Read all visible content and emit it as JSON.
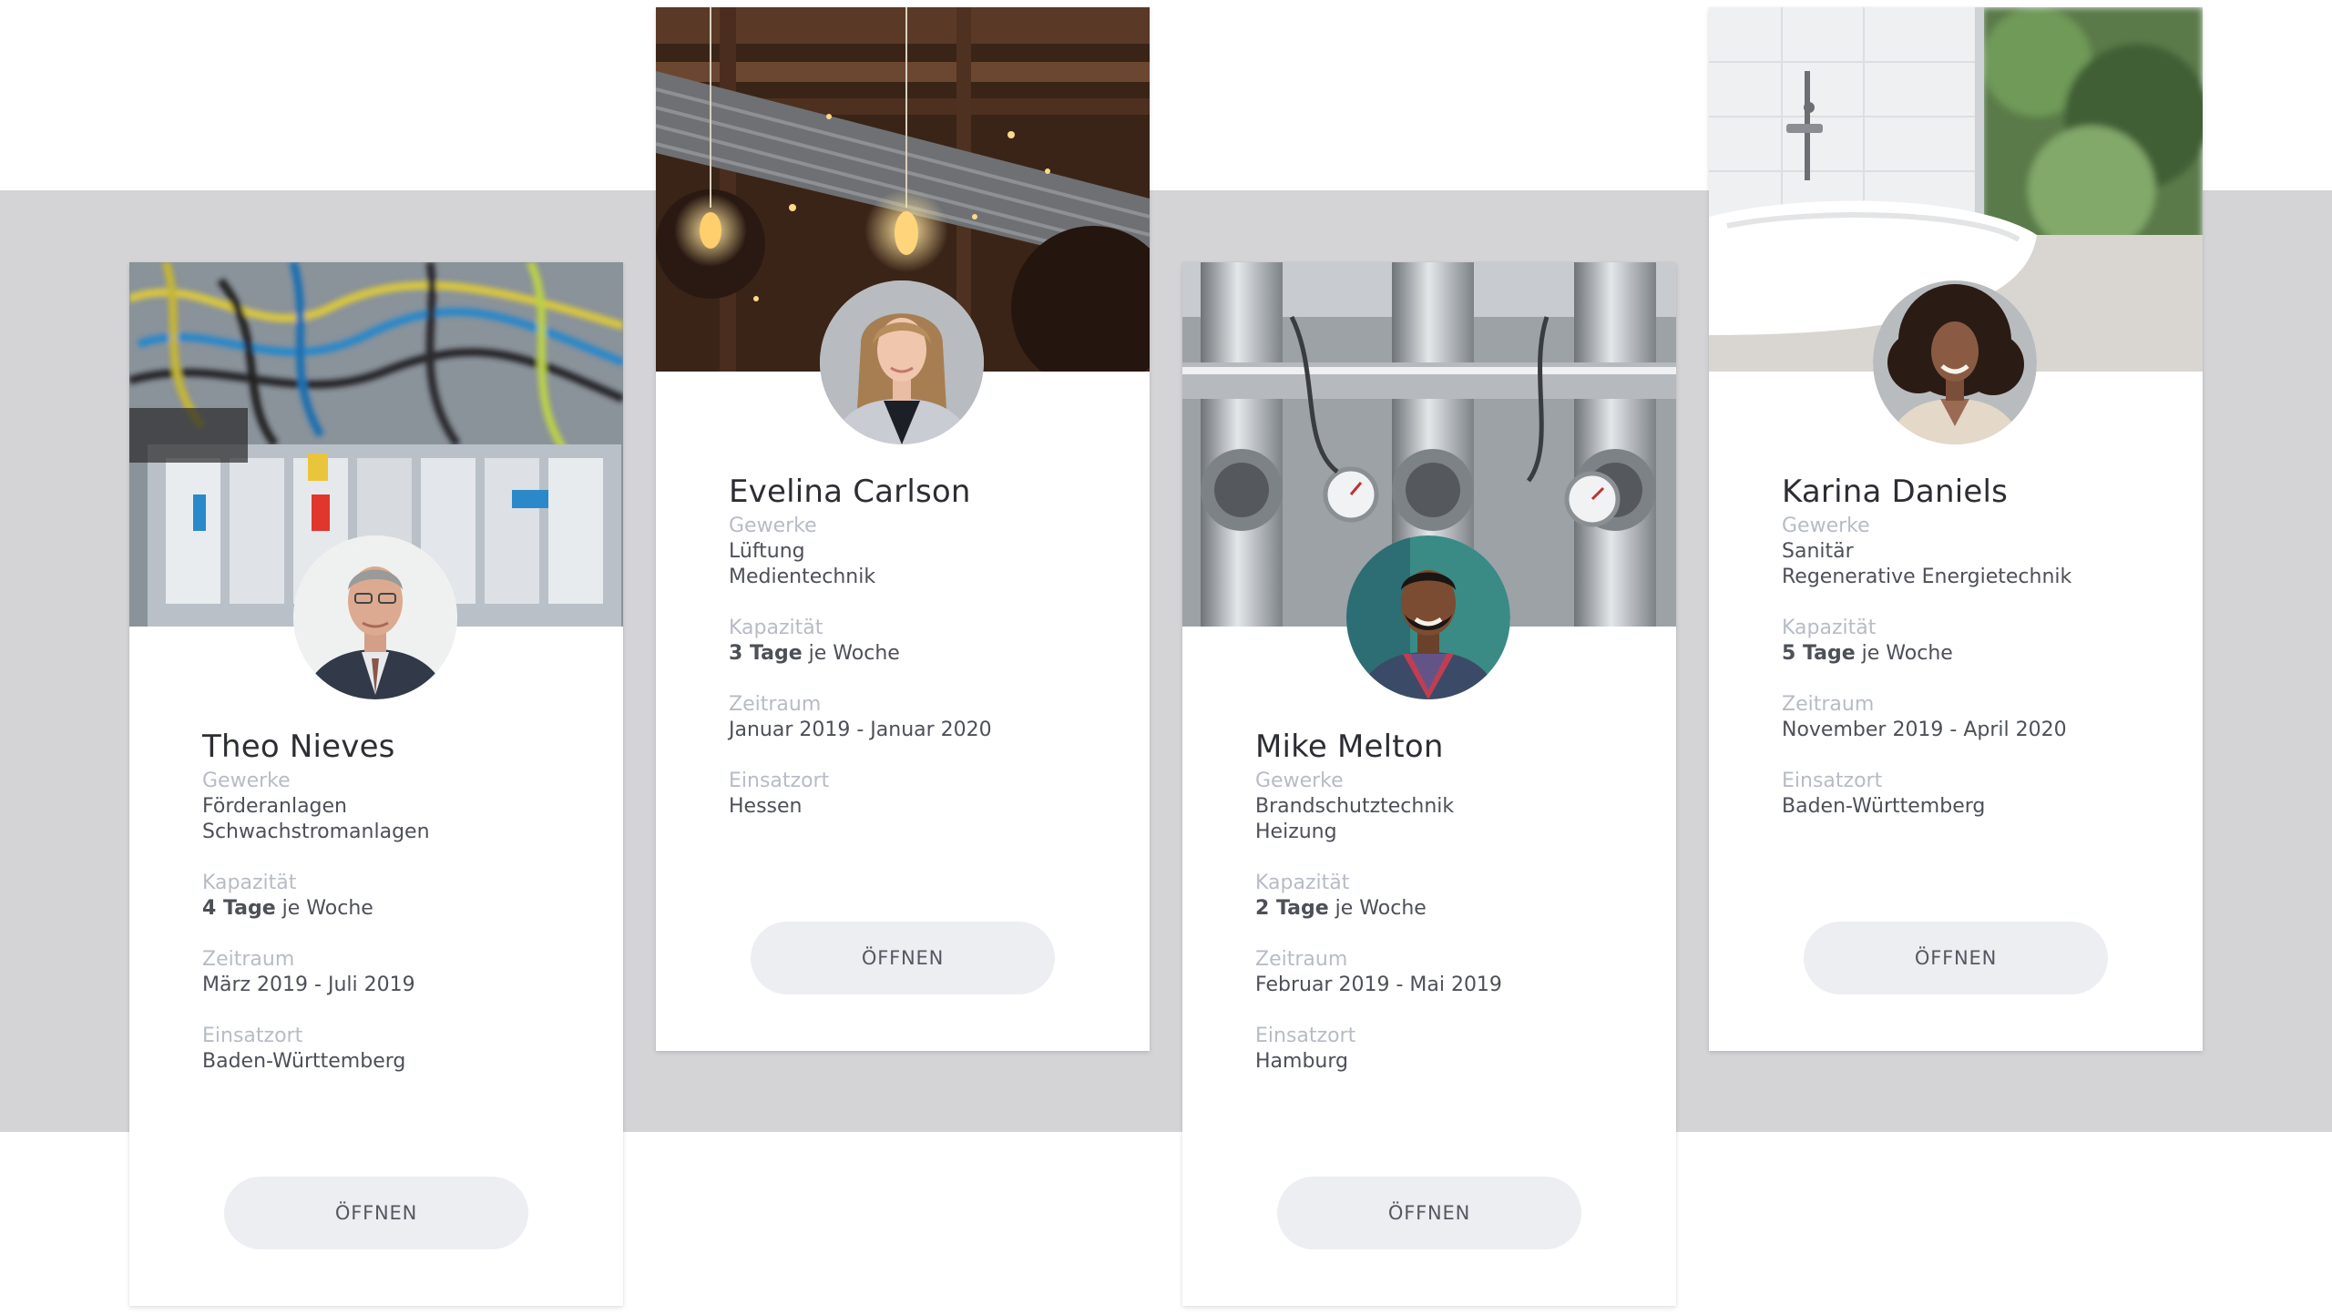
{
  "labels": {
    "trades": "Gewerke",
    "capacity": "Kapazität",
    "period": "Zeitraum",
    "location": "Einsatzort",
    "per_week": "je Woche",
    "open_button": "ÖFFNEN"
  },
  "cards": [
    {
      "name": "Theo Nieves",
      "trades": [
        "Förderanlagen",
        "Schwachstromanlagen"
      ],
      "capacity": "4 Tage",
      "period": "März 2019 - Juli 2019",
      "location": "Baden-Württemberg",
      "cover_image": "electrical-cabinet-wires",
      "avatar_image": "older-man-glasses-suit"
    },
    {
      "name": "Evelina Carlson",
      "trades": [
        "Lüftung",
        "Medientechnik"
      ],
      "capacity": "3 Tage",
      "period": "Januar 2019 - Januar 2020",
      "location": "Hessen",
      "cover_image": "industrial-ceiling-duct-bulbs",
      "avatar_image": "young-woman-blonde-blazer"
    },
    {
      "name": "Mike Melton",
      "trades": [
        "Brandschutztechnik",
        "Heizung"
      ],
      "capacity": "2 Tage",
      "period": "Februar 2019 - Mai 2019",
      "location": "Hamburg",
      "cover_image": "steel-valves-pressure-gauges",
      "avatar_image": "smiling-man-beard-plaid"
    },
    {
      "name": "Karina Daniels",
      "trades": [
        "Sanitär",
        "Regenerative Energietechnik"
      ],
      "capacity": "5 Tage",
      "period": "November 2019 - April 2020",
      "location": "Baden-Württemberg",
      "cover_image": "bathroom-freestanding-tub",
      "avatar_image": "smiling-woman-curly-hair"
    }
  ],
  "colors": {
    "band": "#d4d4d7",
    "card": "#ffffff",
    "name": "#2c2e33",
    "label": "#b7bcc4",
    "value": "#4d5057",
    "button": "#eceef1"
  }
}
